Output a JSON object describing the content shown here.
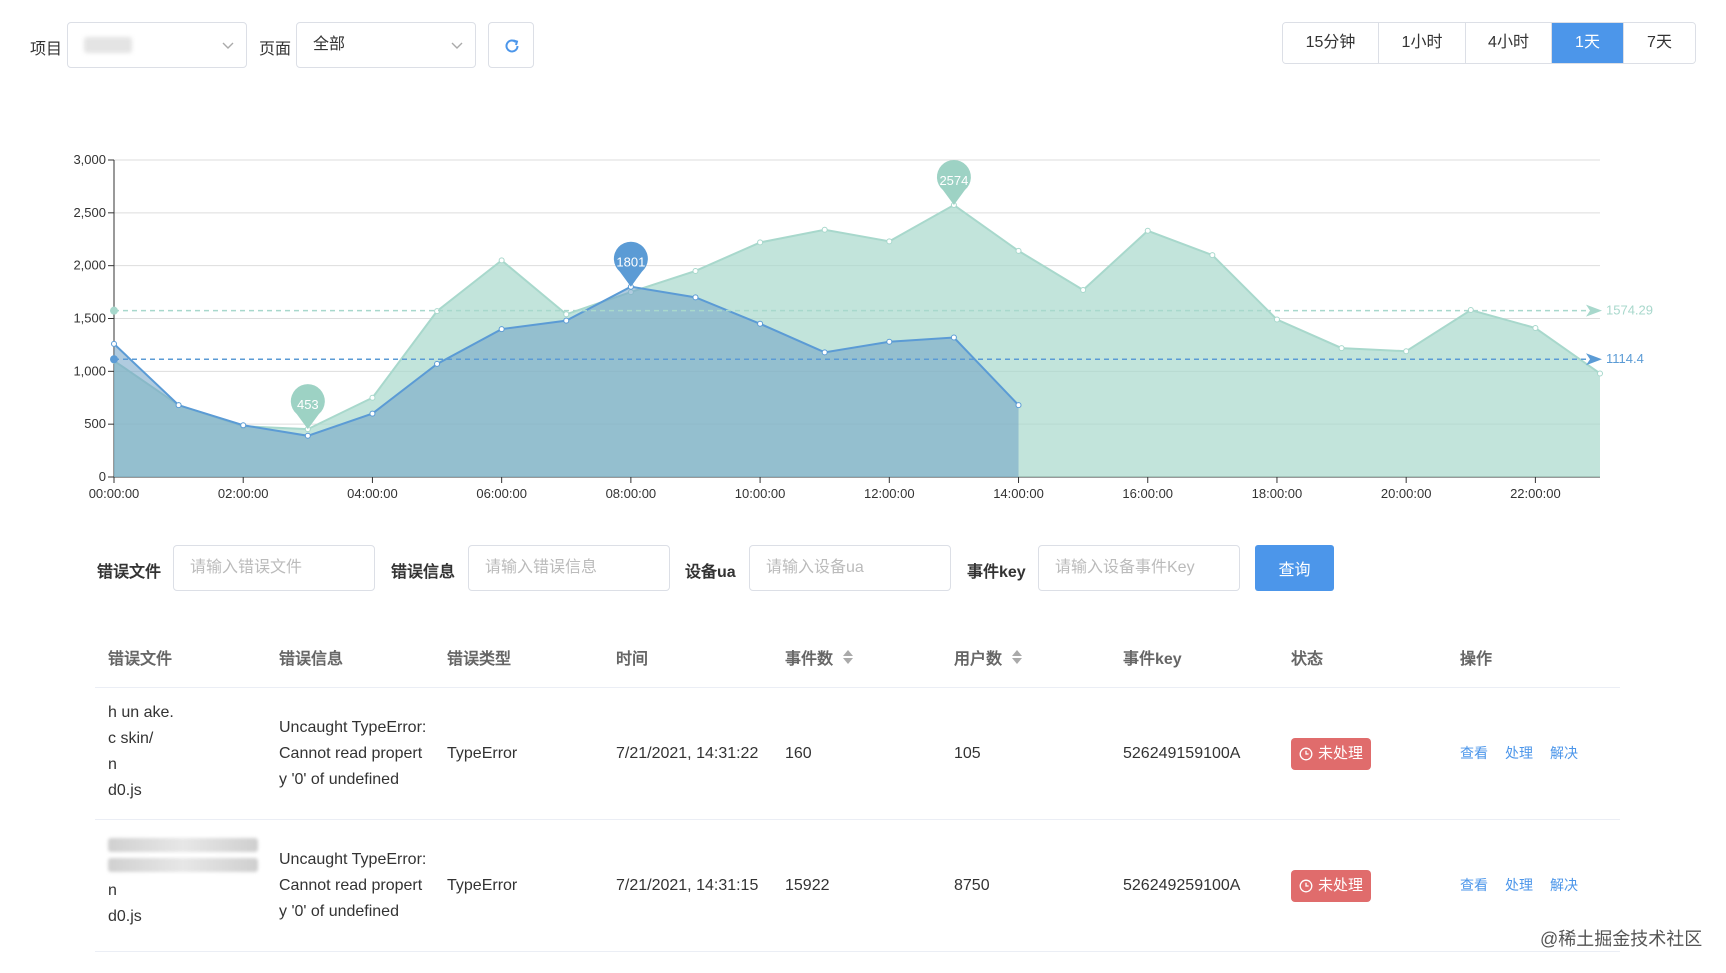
{
  "filters": {
    "project_label": "项目",
    "page_label": "页面",
    "page_value": "全部"
  },
  "time_ranges": [
    {
      "label": "15分钟",
      "active": false
    },
    {
      "label": "1小时",
      "active": false
    },
    {
      "label": "4小时",
      "active": false
    },
    {
      "label": "1天",
      "active": true
    },
    {
      "label": "7天",
      "active": false
    }
  ],
  "chart_data": {
    "type": "area",
    "x": [
      "00:00:00",
      "01:00:00",
      "02:00:00",
      "03:00:00",
      "04:00:00",
      "05:00:00",
      "06:00:00",
      "07:00:00",
      "08:00:00",
      "09:00:00",
      "10:00:00",
      "11:00:00",
      "12:00:00",
      "13:00:00",
      "14:00:00",
      "15:00:00",
      "16:00:00",
      "17:00:00",
      "18:00:00",
      "19:00:00",
      "20:00:00",
      "21:00:00",
      "22:00:00",
      "23:00:00"
    ],
    "xtick_labels": [
      "00:00:00",
      "02:00:00",
      "04:00:00",
      "06:00:00",
      "08:00:00",
      "10:00:00",
      "12:00:00",
      "14:00:00",
      "16:00:00",
      "18:00:00",
      "20:00:00",
      "22:00:00"
    ],
    "ylim": [
      0,
      3000
    ],
    "ytick_labels": [
      "0",
      "500",
      "1,000",
      "1,500",
      "2,000",
      "2,500",
      "3,000"
    ],
    "yticks": [
      0,
      500,
      1000,
      1500,
      2000,
      2500,
      3000
    ],
    "grid": true,
    "series": [
      {
        "color": "#a8d8cc",
        "values": [
          1100,
          680,
          480,
          453,
          750,
          1570,
          2050,
          1540,
          1750,
          1950,
          2220,
          2340,
          2230,
          2574,
          2140,
          1770,
          2330,
          2100,
          1490,
          1220,
          1190,
          1580,
          1410,
          980
        ],
        "max_marker": {
          "label": "2574",
          "x_index": 13,
          "value": 2574
        },
        "min_marker": {
          "label": "453",
          "x_index": 3,
          "value": 453
        },
        "average": {
          "label": "1574.29",
          "value": 1574.29
        }
      },
      {
        "color": "#5b9bd5",
        "values": [
          1260,
          680,
          490,
          390,
          600,
          1070,
          1400,
          1480,
          1801,
          1700,
          1450,
          1180,
          1280,
          1320,
          680
        ],
        "max_marker": {
          "label": "1801",
          "x_index": 8,
          "value": 1801
        },
        "average": {
          "label": "1114.4",
          "value": 1114.4
        }
      }
    ]
  },
  "search": {
    "file_label": "错误文件",
    "file_placeholder": "请输入错误文件",
    "message_label": "错误信息",
    "message_placeholder": "请输入错误信息",
    "ua_label": "设备ua",
    "ua_placeholder": "请输入设备ua",
    "key_label": "事件key",
    "key_placeholder": "请输入设备事件Key",
    "query_label": "查询"
  },
  "table": {
    "headers": {
      "file": "错误文件",
      "message": "错误信息",
      "type": "错误类型",
      "time": "时间",
      "events": "事件数",
      "users": "用户数",
      "key": "事件key",
      "status": "状态",
      "actions": "操作"
    },
    "rows": [
      {
        "file_lines": [
          "h  un  ake.",
          "c  skin/",
          "n",
          "d0.js"
        ],
        "message_lines": [
          "Uncaught TypeError:",
          "Cannot read propert",
          "y '0' of undefined"
        ],
        "type": "TypeError",
        "time": "7/21/2021, 14:31:22",
        "events": "160",
        "users": "105",
        "key": "526249159100A",
        "status": "未处理",
        "actions": [
          "查看",
          "处理",
          "解决"
        ]
      },
      {
        "file_lines": [
          "",
          "",
          "n",
          "d0.js"
        ],
        "message_lines": [
          "Uncaught TypeError:",
          "Cannot read propert",
          "y '0' of undefined"
        ],
        "type": "TypeError",
        "time": "7/21/2021, 14:31:15",
        "events": "15922",
        "users": "8750",
        "key": "526249259100A",
        "status": "未处理",
        "actions": [
          "查看",
          "处理",
          "解决"
        ]
      }
    ]
  },
  "watermark": "@稀土掘金技术社区"
}
